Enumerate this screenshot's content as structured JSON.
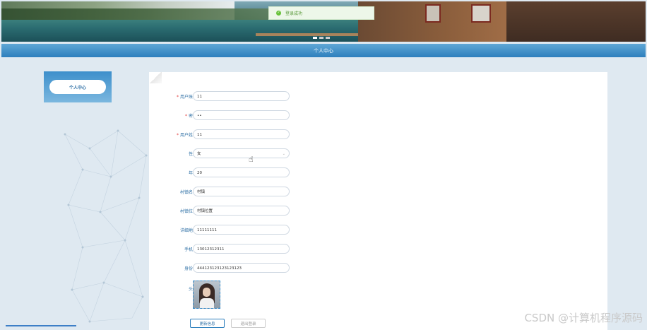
{
  "toast": {
    "icon": "check-circle-icon",
    "text": "登录成功"
  },
  "header": {
    "title": "个人中心"
  },
  "sidebar": {
    "menu_item": "个人中心"
  },
  "form": {
    "fields": [
      {
        "label": "用户账号",
        "required": true,
        "value": "11"
      },
      {
        "label": "密码",
        "required": true,
        "value": "••"
      },
      {
        "label": "用户姓名",
        "required": true,
        "value": "11"
      },
      {
        "label": "性别",
        "required": false,
        "value": "女",
        "type": "select"
      },
      {
        "label": "年龄",
        "required": false,
        "value": "20"
      },
      {
        "label": "村镇名称",
        "required": false,
        "value": "村镇"
      },
      {
        "label": "村镇位置",
        "required": false,
        "value": "村镇位置"
      },
      {
        "label": "详细地址",
        "required": false,
        "value": "11111111"
      },
      {
        "label": "手机号",
        "required": false,
        "value": "13012312311"
      },
      {
        "label": "身份证",
        "required": false,
        "value": "444123123123123123"
      }
    ],
    "avatar_label": "头像",
    "required_mark": "*",
    "update_button": "更新信息",
    "logout_button": "退出登录"
  },
  "watermark": "CSDN @计算机程序源码",
  "colors": {
    "accent": "#2d7fbd",
    "required": "#e23c3c",
    "toast_bg": "#edf7e9"
  }
}
